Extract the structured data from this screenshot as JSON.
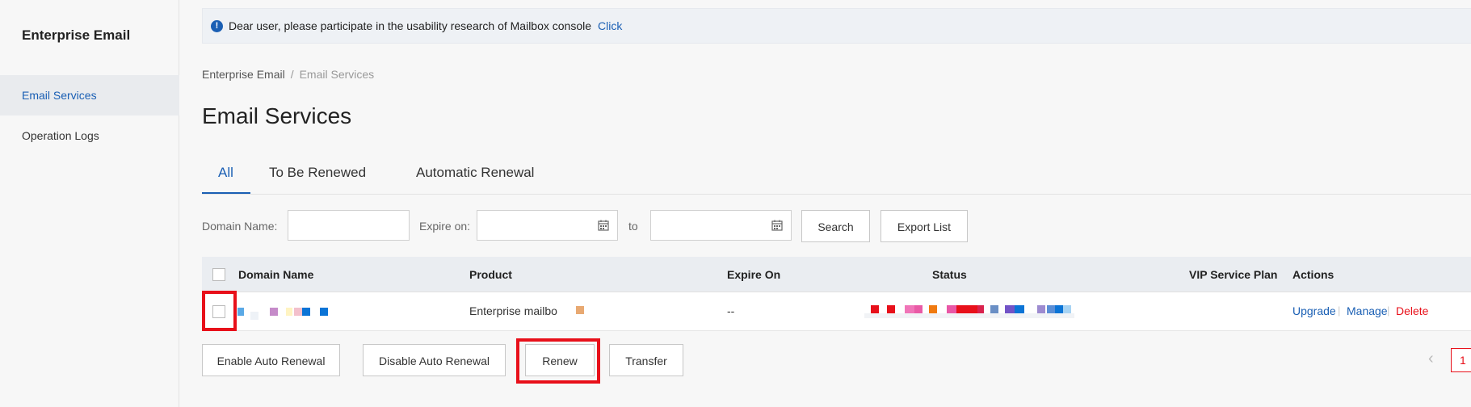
{
  "sidebar": {
    "title": "Enterprise Email",
    "items": [
      {
        "label": "Email Services",
        "active": true
      },
      {
        "label": "Operation Logs",
        "active": false
      }
    ]
  },
  "notice": {
    "icon": "info-icon",
    "text": "Dear user, please participate in the usability research of Mailbox console",
    "link": "Click"
  },
  "breadcrumb": {
    "root": "Enterprise Email",
    "separator": "/",
    "current": "Email Services"
  },
  "page_title": "Email Services",
  "tabs": [
    {
      "label": "All",
      "active": true
    },
    {
      "label": "To Be Renewed",
      "active": false
    },
    {
      "label": "Automatic Renewal",
      "active": false
    }
  ],
  "filters": {
    "domain_label": "Domain Name:",
    "domain_value": "",
    "expire_label": "Expire on:",
    "expire_from": "",
    "to_label": "to",
    "expire_to": "",
    "search_button": "Search",
    "export_button": "Export List"
  },
  "table": {
    "columns": [
      "Domain Name",
      "Product",
      "Expire On",
      "Status",
      "VIP Service Plan",
      "Actions"
    ],
    "rows": [
      {
        "domain": "",
        "product": "Enterprise mailbo",
        "expire_on": "--",
        "status": "",
        "vip_plan": "",
        "actions": [
          "Upgrade",
          "Manage",
          "Delete"
        ]
      }
    ]
  },
  "bulk_actions": {
    "enable_auto_renewal": "Enable Auto Renewal",
    "disable_auto_renewal": "Disable Auto Renewal",
    "renew": "Renew",
    "transfer": "Transfer"
  },
  "pagination": {
    "current_page": "1"
  },
  "colors": {
    "accent": "#1a5fb4",
    "danger": "#e8101a",
    "highlight": "#e8101a"
  }
}
